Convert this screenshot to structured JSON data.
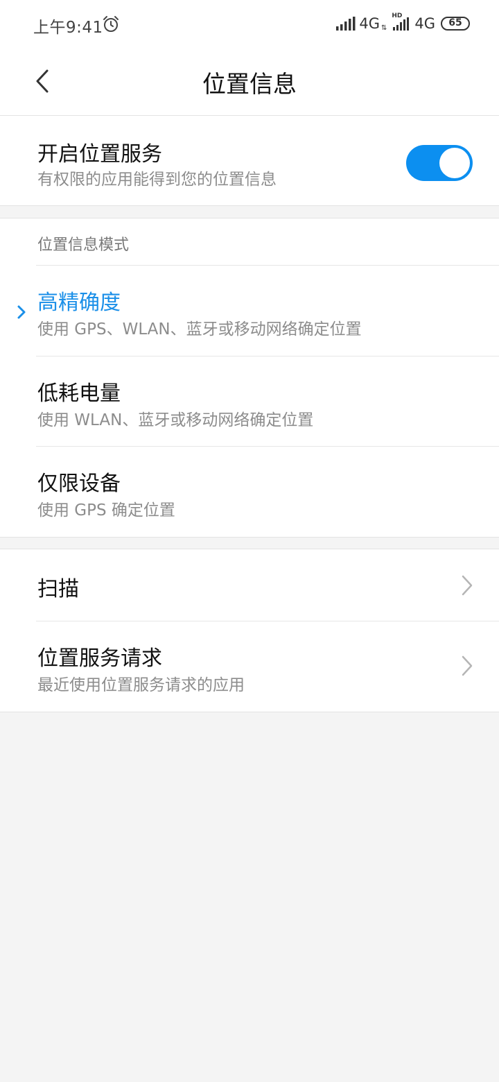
{
  "status_bar": {
    "time": "上午9:41",
    "network_1": "4G",
    "network_1_arrows": "⇅",
    "hd_label": "HD",
    "network_2": "4G",
    "battery": "65",
    "icons": [
      "alarm-icon",
      "signal-icon",
      "signal-icon",
      "battery-icon"
    ]
  },
  "header": {
    "title": "位置信息",
    "back_icon": "chevron-left-icon"
  },
  "location_service": {
    "title": "开启位置服务",
    "subtitle": "有权限的应用能得到您的位置信息",
    "enabled": true,
    "toggle_color": "#0c8ff0"
  },
  "mode_section": {
    "header": "位置信息模式",
    "options": [
      {
        "title": "高精确度",
        "subtitle": "使用 GPS、WLAN、蓝牙或移动网络确定位置",
        "selected": true
      },
      {
        "title": "低耗电量",
        "subtitle": "使用 WLAN、蓝牙或移动网络确定位置",
        "selected": false
      },
      {
        "title": "仅限设备",
        "subtitle": "使用 GPS 确定位置",
        "selected": false
      }
    ],
    "accent_color": "#1a8fe8"
  },
  "more_section": {
    "items": [
      {
        "title": "扫描",
        "subtitle": ""
      },
      {
        "title": "位置服务请求",
        "subtitle": "最近使用位置服务请求的应用"
      }
    ]
  }
}
